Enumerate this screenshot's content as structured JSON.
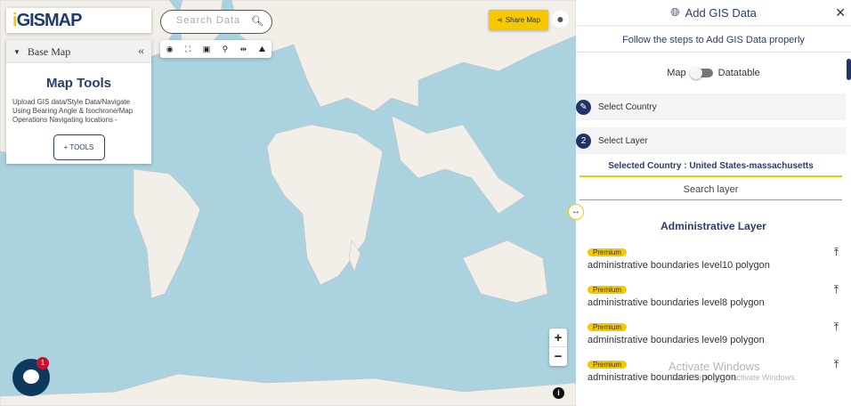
{
  "logo": {
    "text": "GISMAP",
    "prefix": "i"
  },
  "basemap": {
    "label": "Base Map"
  },
  "map_tools": {
    "title": "Map Tools",
    "description": "Upload GIS data/Style Data/Navigate Using Bearing Angle & Isochrone/Map Operations Navigating locations -",
    "button": "+ TOOLS"
  },
  "search": {
    "placeholder": "Search Data"
  },
  "share": {
    "label": "Share Map"
  },
  "chat": {
    "badge": "1"
  },
  "zoom": {
    "in": "+",
    "out": "−"
  },
  "panel": {
    "title": "Add GIS Data",
    "subtitle": "Follow the steps to Add GIS Data properly",
    "toggle": {
      "left": "Map",
      "right": "Datatable"
    },
    "steps": [
      {
        "label": "Select Country",
        "marker": "✎"
      },
      {
        "label": "Select Layer",
        "marker": "2"
      }
    ],
    "selected_country": "Selected Country : United States-massachusetts",
    "search_layer": "Search layer",
    "section": "Administrative Layer",
    "items": [
      {
        "badge": "Premium",
        "name": "administrative boundaries level10 polygon"
      },
      {
        "badge": "Premium",
        "name": "administrative boundaries level8 polygon"
      },
      {
        "badge": "Premium",
        "name": "administrative boundaries level9 polygon"
      },
      {
        "badge": "Premium",
        "name": "administrative boundaries polygon"
      }
    ]
  },
  "watermark": {
    "title": "Activate Windows",
    "sub": "Go to Settings to activate Windows."
  }
}
